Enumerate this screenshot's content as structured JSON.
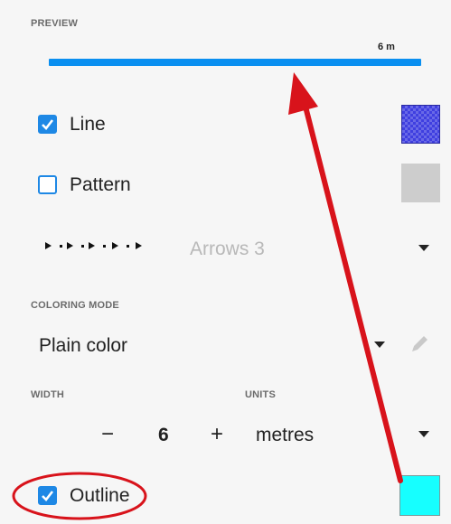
{
  "preview": {
    "section_label": "PREVIEW",
    "scale_label": "6 m",
    "line_color": "#0a8ff0"
  },
  "line_row": {
    "label": "Line",
    "checked": true,
    "swatch_color": "#3f3fe0"
  },
  "pattern_row": {
    "label": "Pattern",
    "checked": false,
    "swatch_color": "#cdcdcd"
  },
  "arrows_row": {
    "value": "Arrows 3"
  },
  "coloring": {
    "section_label": "COLORING MODE",
    "value": "Plain color"
  },
  "width_units": {
    "width_label": "WIDTH",
    "units_label": "UNITS",
    "decrement_label": "−",
    "width_value": "6",
    "increment_label": "+",
    "units_value": "metres"
  },
  "outline_row": {
    "label": "Outline",
    "checked": true,
    "swatch_color": "#16ffff"
  },
  "icons": {
    "checkbox": "check-icon",
    "dropdown": "chevron-down-icon",
    "edit": "pencil-icon",
    "annotation": "red-arrow-and-circle"
  },
  "annotation_color": "#d8131b"
}
